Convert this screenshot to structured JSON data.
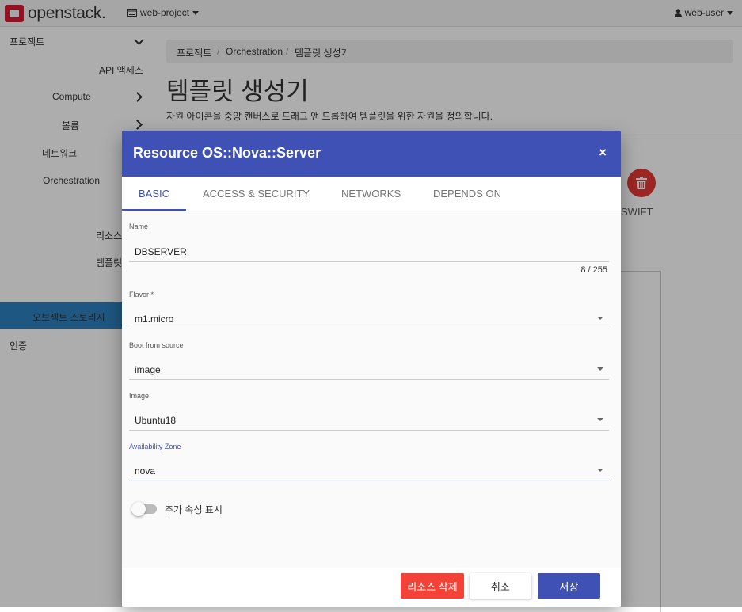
{
  "header": {
    "logo_text": "openstack.",
    "project": "web-project",
    "user": "web-user"
  },
  "sidebar": {
    "items": [
      {
        "label": "프로젝트"
      },
      {
        "label": "API 액세스"
      },
      {
        "label": "Compute"
      },
      {
        "label": "볼륨"
      },
      {
        "label": "네트워크"
      },
      {
        "label": "Orchestration"
      },
      {
        "label": "리소스"
      },
      {
        "label": "템플릿"
      },
      {
        "label": "템플릿 생"
      },
      {
        "label": "오브젝트 스토리지"
      },
      {
        "label": "인증"
      }
    ]
  },
  "breadcrumb": [
    "프로젝트",
    "Orchestration",
    "템플릿 생성기"
  ],
  "page": {
    "title": "템플릿 생성기",
    "description": "자원 아이콘을 중앙 캔버스로 드래그 앤 드롭하여 템플릿을 위한 자원을 정의합니다.",
    "swift_label": "SWIFT"
  },
  "modal": {
    "title": "Resource OS::Nova::Server",
    "close_icon": "×",
    "tabs": [
      {
        "label": "BASIC"
      },
      {
        "label": "ACCESS & SECURITY"
      },
      {
        "label": "NETWORKS"
      },
      {
        "label": "DEPENDS ON"
      }
    ],
    "fields": {
      "name": {
        "label": "Name",
        "value": "DBSERVER",
        "counter": "8 / 255"
      },
      "flavor": {
        "label": "Flavor *",
        "value": "m1.micro"
      },
      "boot_source": {
        "label": "Boot from source",
        "value": "image"
      },
      "image": {
        "label": "Image",
        "value": "Ubuntu18"
      },
      "availability_zone": {
        "label": "Availability Zone",
        "value": "nova"
      }
    },
    "toggle_label": "추가 속성 표시",
    "buttons": {
      "delete": "리소스 삭제",
      "cancel": "취소",
      "save": "저장"
    }
  },
  "colors": {
    "accent": "#3f51b5",
    "danger": "#f44336",
    "brand": "#da1a32",
    "sidebar_active": "#2d80bf"
  }
}
